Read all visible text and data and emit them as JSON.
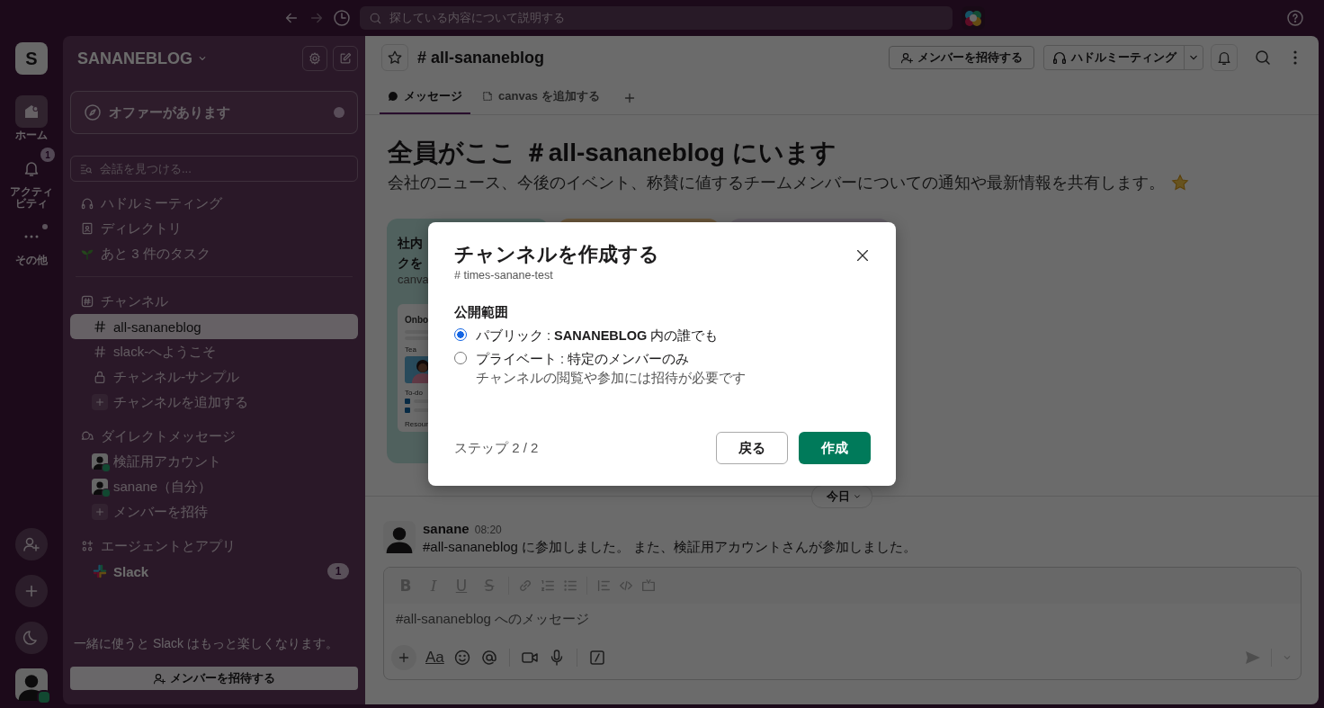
{
  "topbar": {
    "search_placeholder": "探している内容について説明する"
  },
  "rail": {
    "workspace_initial": "S",
    "items": [
      {
        "label": "ホーム",
        "kind": "home",
        "selected": true
      },
      {
        "label": "アクティビティ",
        "kind": "activity",
        "selected": false,
        "badge": "1"
      },
      {
        "label": "その他",
        "kind": "more",
        "selected": false
      }
    ]
  },
  "sidebar": {
    "workspace": "SANANEBLOG",
    "offer": "オファーがあります",
    "find_placeholder": "会話を見つける...",
    "shortcuts": [
      {
        "label": "ハドルミーティング",
        "kind": "huddle"
      },
      {
        "label": "ディレクトリ",
        "kind": "directory"
      },
      {
        "label": "あと 3 件のタスク",
        "kind": "tasks"
      }
    ],
    "sections": [
      {
        "title": "チャンネル",
        "kind": "channels",
        "items": [
          {
            "label": "all-sananeblog",
            "kind": "public",
            "selected": true,
            "unread": false
          },
          {
            "label": "slack-へようこそ",
            "kind": "public",
            "selected": false,
            "unread": false
          },
          {
            "label": "チャンネル-サンプル",
            "kind": "private",
            "selected": false,
            "unread": false
          },
          {
            "label": "チャンネルを追加する",
            "kind": "add",
            "selected": false,
            "unread": false
          }
        ]
      },
      {
        "title": "ダイレクトメッセージ",
        "kind": "dms",
        "items": [
          {
            "label": "検証用アカウント",
            "kind": "user",
            "selected": false,
            "unread": false
          },
          {
            "label": "sanane（自分）",
            "kind": "user",
            "selected": false,
            "unread": false
          },
          {
            "label": "メンバーを招待",
            "kind": "add",
            "selected": false,
            "unread": false
          }
        ]
      },
      {
        "title": "エージェントとアプリ",
        "kind": "apps",
        "items": [
          {
            "label": "Slack",
            "kind": "app",
            "selected": false,
            "unread": true,
            "badge": "1"
          }
        ]
      }
    ],
    "footer_note": "一緒に使うと Slack はもっと楽しくなります。",
    "invite_button": "メンバーを招待する"
  },
  "channel": {
    "name": "# all-sananeblog",
    "invite_button": "メンバーを招待する",
    "huddle_button": "ハドルミーティング",
    "tabs": [
      {
        "label": "メッセージ",
        "kind": "messages",
        "selected": true
      },
      {
        "label": "canvas を追加する",
        "kind": "canvas",
        "selected": false
      }
    ],
    "intro": {
      "title": "全員がここ ＃all-sananeblog にいます",
      "description": "会社のニュース、今後のイベント、称賛に値するチームメンバーについての通知や最新情報を共有します。"
    },
    "cards": [
      {
        "kind": "template",
        "lines": [
          "社内",
          "クを"
        ],
        "subtitle": "canva",
        "preview": {
          "title": "Onbo",
          "person_label": "Tea",
          "todo": "To-do",
          "resources": "Resour"
        }
      },
      {
        "kind": "template"
      },
      {
        "kind": "template"
      }
    ],
    "divider": "今日",
    "message": {
      "author": "sanane",
      "time": "08:20",
      "text": "#all-sananeblog に参加しました。 また、検証用アカウントさんが参加しました。"
    },
    "composer": {
      "format_buttons": [
        "B",
        "I",
        "U",
        "S"
      ],
      "placeholder": "#all-sananeblog へのメッセージ",
      "text_style": "Aa"
    }
  },
  "modal": {
    "title": "チャンネルを作成する",
    "channel": "# times-sanane-test",
    "visibility_label": "公開範囲",
    "options": [
      {
        "label": "パブリック : **SANANEBLOG** 内の誰でも",
        "selected": true
      },
      {
        "label": "プライベート : 特定のメンバーのみ",
        "description": "チャンネルの閲覧や参加には招待が必要です",
        "selected": false
      }
    ],
    "step": "ステップ 2 / 2",
    "back_button": "戻る",
    "create_button": "作成"
  }
}
